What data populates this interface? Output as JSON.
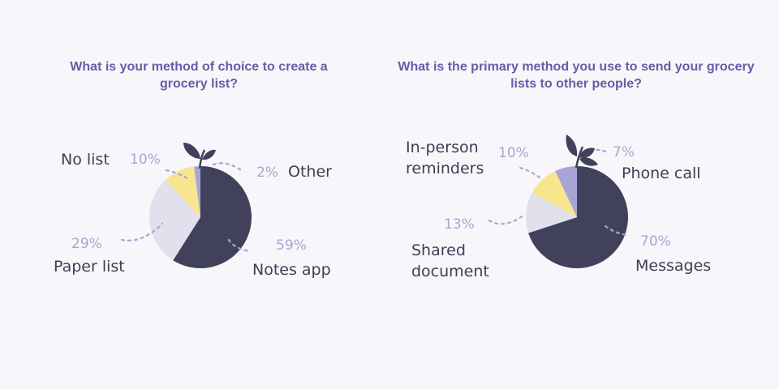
{
  "colors": {
    "title": "#6b5aa6",
    "label": "#3e3e54",
    "percent": "#a9a4d0",
    "background": "#f8f6fa"
  },
  "chart_data": [
    {
      "type": "pie",
      "title": "What is your method of choice to create a grocery list?",
      "slices": [
        {
          "name": "Notes app",
          "value": 59,
          "label": "59%",
          "color": "#41415c"
        },
        {
          "name": "Paper list",
          "value": 29,
          "label": "29%",
          "color": "#e3e0ee"
        },
        {
          "name": "No list",
          "value": 10,
          "label": "10%",
          "color": "#f7e68e"
        },
        {
          "name": "Other",
          "value": 2,
          "label": "2%",
          "color": "#a9a4d6"
        }
      ],
      "decoration": "sprout-icon"
    },
    {
      "type": "pie",
      "title": "What is the primary method you use to send your grocery lists to other people?",
      "slices": [
        {
          "name": "Messages",
          "value": 70,
          "label": "70%",
          "color": "#41415c"
        },
        {
          "name": "Shared document",
          "value": 13,
          "label": "13%",
          "color": "#e3e0ee"
        },
        {
          "name": "In-person reminders",
          "value": 10,
          "label": "10%",
          "color": "#f7e68e"
        },
        {
          "name": "Phone call",
          "value": 7,
          "label": "7%",
          "color": "#a9a4d6"
        }
      ],
      "decoration": "sprout-icon"
    }
  ]
}
